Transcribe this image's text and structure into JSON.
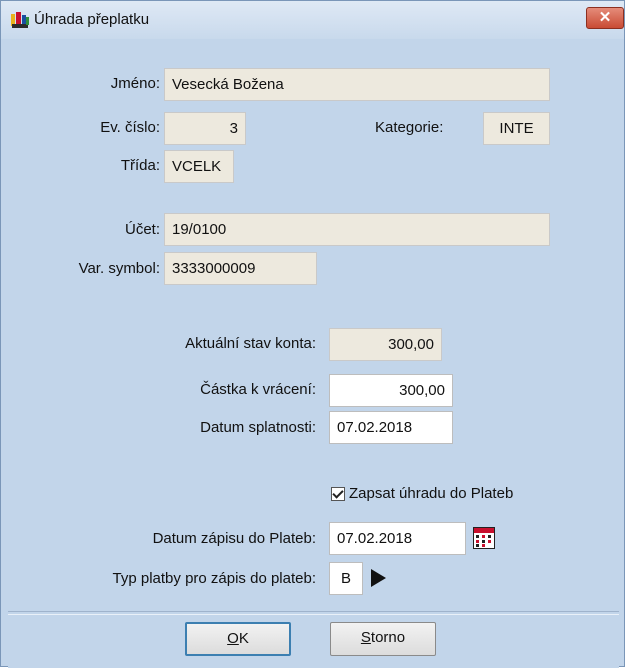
{
  "window": {
    "title": "Úhrada přeplatku",
    "close_symbol": "✕"
  },
  "fields": {
    "jmeno": {
      "label": "Jméno:",
      "value": "Vesecká Božena"
    },
    "ev_cislo": {
      "label": "Ev. číslo:",
      "value": "3"
    },
    "kategorie": {
      "label": "Kategorie:",
      "value": "INTE"
    },
    "trida": {
      "label": "Třída:",
      "value": "VCELK"
    },
    "ucet": {
      "label": "Účet:",
      "value": "19/0100"
    },
    "var_symbol": {
      "label": "Var. symbol:",
      "value": "3333000009"
    },
    "aktualni_stav": {
      "label": "Aktuální stav konta:",
      "value": "300,00"
    },
    "castka": {
      "label": "Částka k vrácení:",
      "value": "300,00"
    },
    "datum_splatnosti": {
      "label": "Datum splatnosti:",
      "value": "07.02.2018"
    },
    "zapsat": {
      "label": "Zapsat úhradu do Plateb",
      "checked": true
    },
    "datum_zapisu": {
      "label": "Datum zápisu do Plateb:",
      "value": "07.02.2018"
    },
    "typ_platby": {
      "label": "Typ platby pro zápis do plateb:",
      "value": "B"
    }
  },
  "buttons": {
    "ok": {
      "accel": "O",
      "rest": "K"
    },
    "storno": {
      "accel": "S",
      "rest": "torno"
    }
  },
  "icons": {
    "app": "app-icon",
    "calendar": "calendar-icon",
    "play": "play-arrow-icon"
  },
  "colors": {
    "dialog_bg": "#c2d5ea",
    "readonly_field": "#ede9de",
    "close_button": "#c94b34"
  }
}
